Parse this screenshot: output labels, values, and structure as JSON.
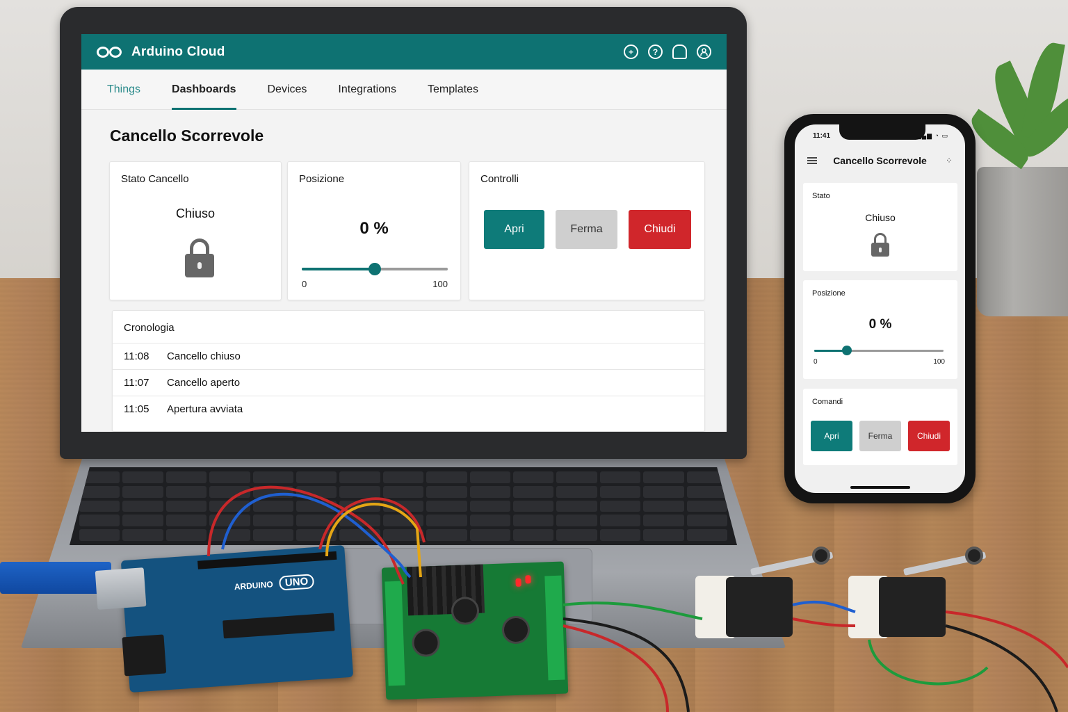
{
  "laptop": {
    "app": {
      "brand": "Arduino Cloud"
    },
    "tabs": [
      {
        "label": "Things"
      },
      {
        "label": "Dashboards"
      },
      {
        "label": "Devices"
      },
      {
        "label": "Integrations"
      },
      {
        "label": "Templates"
      }
    ],
    "active_tab": "Dashboards",
    "dashboard": {
      "title": "Cancello Scorrevole",
      "state_card": {
        "title": "Stato Cancello",
        "value": "Chiuso",
        "icon": "lock-icon"
      },
      "position_card": {
        "title": "Posizione",
        "value_label": "0 %",
        "value": 0.5,
        "min": "0",
        "max": "100"
      },
      "controls_card": {
        "title": "Controlli",
        "buttons": [
          {
            "label": "Apri",
            "color": "#0e7b79"
          },
          {
            "label": "Ferma",
            "color": "#cfcfcf"
          },
          {
            "label": "Chiudi",
            "color": "#d0262b"
          }
        ]
      },
      "history_card": {
        "title": "Cronologia",
        "rows": [
          {
            "time": "11:08",
            "event": "Cancello chiuso"
          },
          {
            "time": "11:07",
            "event": "Cancello aperto"
          },
          {
            "time": "11:05",
            "event": "Apertura avviata"
          }
        ]
      }
    },
    "accent_color": "#0e7272"
  },
  "phone": {
    "status_time": "11:41",
    "title": "Cancello Scorrevole",
    "state_card": {
      "title": "Stato",
      "value": "Chiuso"
    },
    "position_card": {
      "title": "Posizione",
      "value_label": "0 %",
      "value": 0.25,
      "min": "0",
      "max": "100"
    },
    "commands_card": {
      "title": "Comandi",
      "buttons": [
        {
          "label": "Apri"
        },
        {
          "label": "Ferma"
        },
        {
          "label": "Chiudi"
        }
      ]
    }
  },
  "hardware": {
    "board_label": "UNO",
    "board_brand": "ARDUINO"
  }
}
